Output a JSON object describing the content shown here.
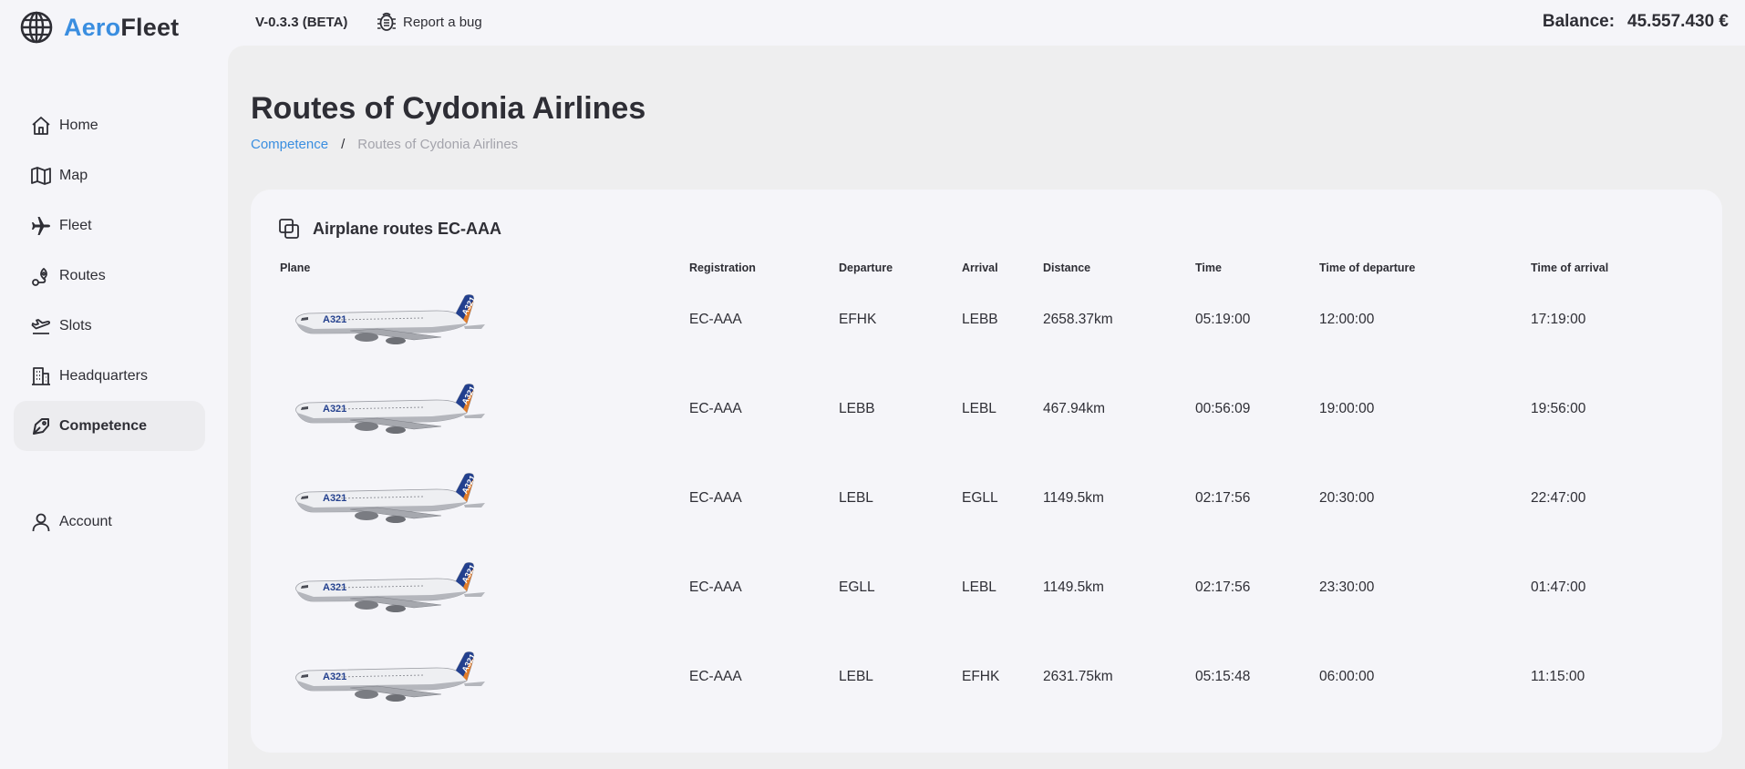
{
  "app": {
    "logo_part1": "Aero",
    "logo_part2": "Fleet",
    "version": "V-0.3.3 (BETA)",
    "report_bug": "Report a bug",
    "balance_label": "Balance:",
    "balance_value": "45.557.430 €"
  },
  "sidebar": {
    "items": [
      {
        "label": "Home",
        "icon": "home-icon"
      },
      {
        "label": "Map",
        "icon": "map-icon"
      },
      {
        "label": "Fleet",
        "icon": "plane-icon"
      },
      {
        "label": "Routes",
        "icon": "route-icon"
      },
      {
        "label": "Slots",
        "icon": "departure-icon"
      },
      {
        "label": "Headquarters",
        "icon": "building-icon"
      },
      {
        "label": "Competence",
        "icon": "competence-icon",
        "active": true
      },
      {
        "label": "Account",
        "icon": "user-icon"
      }
    ]
  },
  "page": {
    "title": "Routes of Cydonia Airlines",
    "breadcrumb": {
      "link": "Competence",
      "separator": "/",
      "current": "Routes of Cydonia Airlines"
    }
  },
  "card": {
    "title": "Airplane routes EC-AAA",
    "icon": "copy-icon"
  },
  "table": {
    "headers": [
      "Plane",
      "Registration",
      "Departure",
      "Arrival",
      "Distance",
      "Time",
      "Time of departure",
      "Time of arrival"
    ],
    "rows": [
      {
        "plane_model": "A321",
        "registration": "EC-AAA",
        "departure": "EFHK",
        "arrival": "LEBB",
        "distance": "2658.37km",
        "time": "05:19:00",
        "time_of_departure": "12:00:00",
        "time_of_arrival": "17:19:00"
      },
      {
        "plane_model": "A321",
        "registration": "EC-AAA",
        "departure": "LEBB",
        "arrival": "LEBL",
        "distance": "467.94km",
        "time": "00:56:09",
        "time_of_departure": "19:00:00",
        "time_of_arrival": "19:56:00"
      },
      {
        "plane_model": "A321",
        "registration": "EC-AAA",
        "departure": "LEBL",
        "arrival": "EGLL",
        "distance": "1149.5km",
        "time": "02:17:56",
        "time_of_departure": "20:30:00",
        "time_of_arrival": "22:47:00"
      },
      {
        "plane_model": "A321",
        "registration": "EC-AAA",
        "departure": "EGLL",
        "arrival": "LEBL",
        "distance": "1149.5km",
        "time": "02:17:56",
        "time_of_departure": "23:30:00",
        "time_of_arrival": "01:47:00"
      },
      {
        "plane_model": "A321",
        "registration": "EC-AAA",
        "departure": "LEBL",
        "arrival": "EFHK",
        "distance": "2631.75km",
        "time": "05:15:48",
        "time_of_departure": "06:00:00",
        "time_of_arrival": "11:15:00"
      }
    ]
  },
  "colors": {
    "accent": "#3a8ee0",
    "text": "#2e2e35",
    "muted": "#a4a4ac",
    "main_bg": "#eeeeef",
    "card_bg": "#f5f5f9"
  }
}
